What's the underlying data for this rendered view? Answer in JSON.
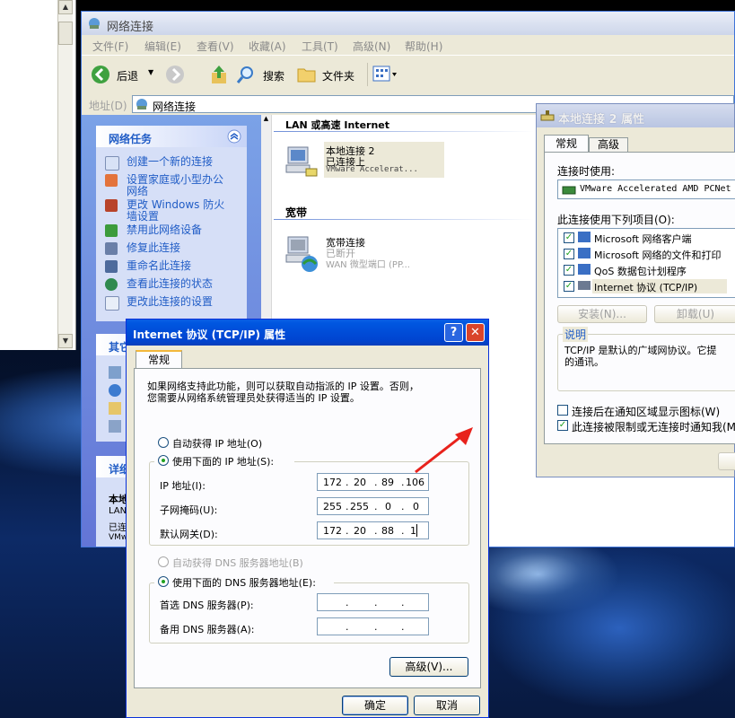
{
  "explorer": {
    "title": "网络连接",
    "menu": [
      "文件(F)",
      "编辑(E)",
      "查看(V)",
      "收藏(A)",
      "工具(T)",
      "高级(N)",
      "帮助(H)"
    ],
    "toolbar": {
      "back": "后退",
      "search": "搜索",
      "folders": "文件夹"
    },
    "address_label": "地址(D)",
    "address_value": "网络连接",
    "tasks_title": "网络任务",
    "tasks": [
      "创建一个新的连接",
      "设置家庭或小型办公网络",
      "更改 Windows 防火墙设置",
      "禁用此网络设备",
      "修复此连接",
      "重命名此连接",
      "查看此连接的状态",
      "更改此连接的设置"
    ],
    "other_title": "其它",
    "details_title": "详细",
    "details_lines": [
      "本地",
      "LAN",
      "已连",
      "VMw"
    ],
    "sections": [
      {
        "title": "LAN 或高速 Internet",
        "item": {
          "name": "本地连接 2",
          "status": "已连接上",
          "device": "VMware Accelerat..."
        }
      },
      {
        "title": "宽带",
        "item": {
          "name": "宽带连接",
          "status": "已断开",
          "device": "WAN 微型端口 (PP..."
        }
      }
    ]
  },
  "props": {
    "title": "本地连接 2 属性",
    "tabs": [
      "常规",
      "高级"
    ],
    "connect_using_label": "连接时使用:",
    "adapter": "VMware Accelerated AMD PCNet",
    "items_label": "此连接使用下列项目(O):",
    "items": [
      "Microsoft 网络客户端",
      "Microsoft 网络的文件和打印",
      "QoS 数据包计划程序",
      "Internet 协议 (TCP/IP)"
    ],
    "install": "安装(N)...",
    "uninstall": "卸载(U)",
    "desc_label": "说明",
    "desc_text": "TCP/IP 是默认的广域网协议。它提供跨越多种互联网络的通讯。",
    "desc_line1": "TCP/IP 是默认的广域网协议。它提",
    "desc_line2": "的通讯。",
    "show_icon": "连接后在通知区域显示图标(W)",
    "notify": "此连接被限制或无连接时通知我(M)"
  },
  "dialog": {
    "title": "Internet 协议 (TCP/IP) 属性",
    "help_btn": "?",
    "close_btn": "✕",
    "tab": "常规",
    "intro_line1": "如果网络支持此功能，则可以获取自动指派的 IP 设置。否则，",
    "intro_line2": "您需要从网络系统管理员处获得适当的 IP 设置。",
    "auto_ip": "自动获得 IP 地址(O)",
    "manual_ip": "使用下面的 IP 地址(S):",
    "ip_label": "IP 地址(I):",
    "ip": [
      "172",
      "20",
      "89",
      "106"
    ],
    "mask_label": "子网掩码(U):",
    "mask": [
      "255",
      "255",
      "0",
      "0"
    ],
    "gateway_label": "默认网关(D):",
    "gateway": [
      "172",
      "20",
      "88",
      "1"
    ],
    "auto_dns": "自动获得 DNS 服务器地址(B)",
    "manual_dns": "使用下面的 DNS 服务器地址(E):",
    "pref_dns_label": "首选 DNS 服务器(P):",
    "alt_dns_label": "备用 DNS 服务器(A):",
    "advanced": "高级(V)...",
    "ok": "确定",
    "cancel": "取消"
  },
  "colors": {
    "accent": "#0054e3",
    "arrow": "#e8221c"
  }
}
